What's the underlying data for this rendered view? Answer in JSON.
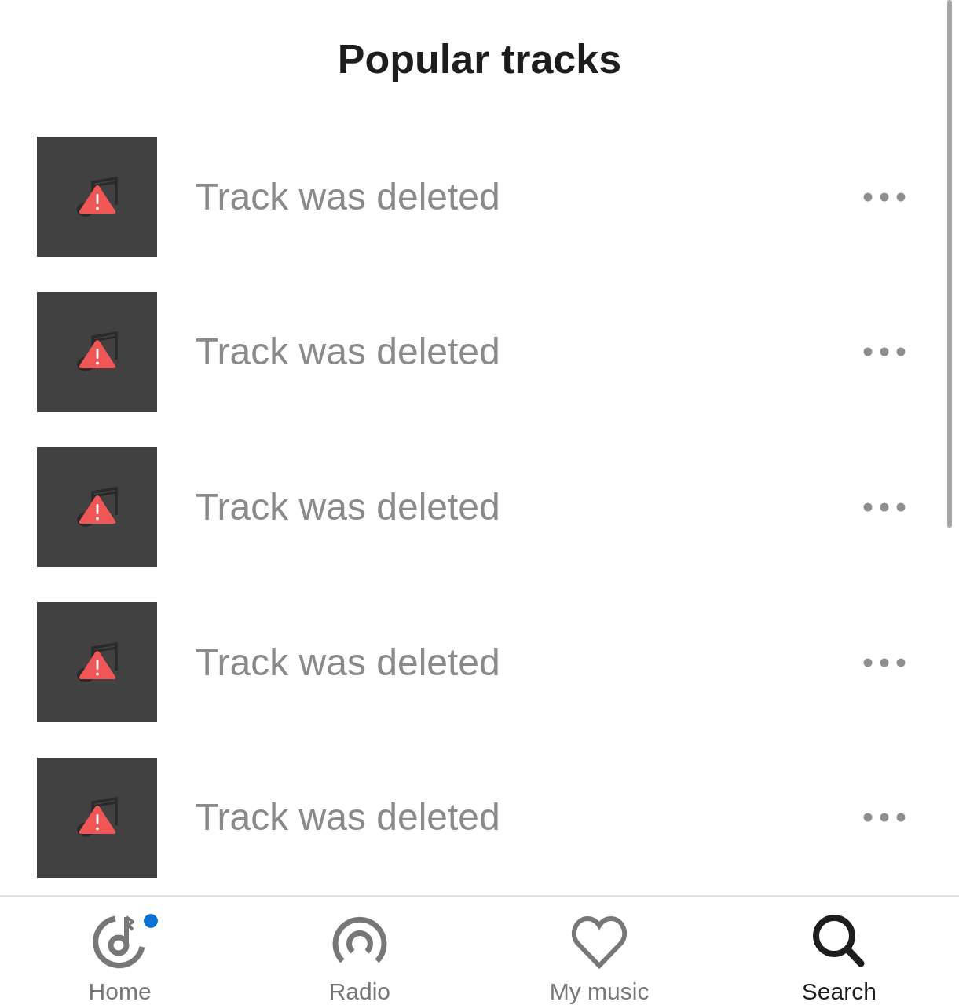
{
  "header": {
    "title": "Popular tracks"
  },
  "tracks": [
    {
      "title": "Track was deleted",
      "deleted": true
    },
    {
      "title": "Track was deleted",
      "deleted": true
    },
    {
      "title": "Track was deleted",
      "deleted": true
    },
    {
      "title": "Track was deleted",
      "deleted": true
    },
    {
      "title": "Track was deleted",
      "deleted": true
    }
  ],
  "nav": {
    "tabs": [
      {
        "kind": "home",
        "label": "Home",
        "selected": false,
        "notification": true
      },
      {
        "kind": "radio",
        "label": "Radio",
        "selected": false,
        "notification": false
      },
      {
        "kind": "favorites",
        "label": "My music",
        "selected": false,
        "notification": false
      },
      {
        "kind": "search",
        "label": "Search",
        "selected": true,
        "notification": false
      }
    ]
  }
}
